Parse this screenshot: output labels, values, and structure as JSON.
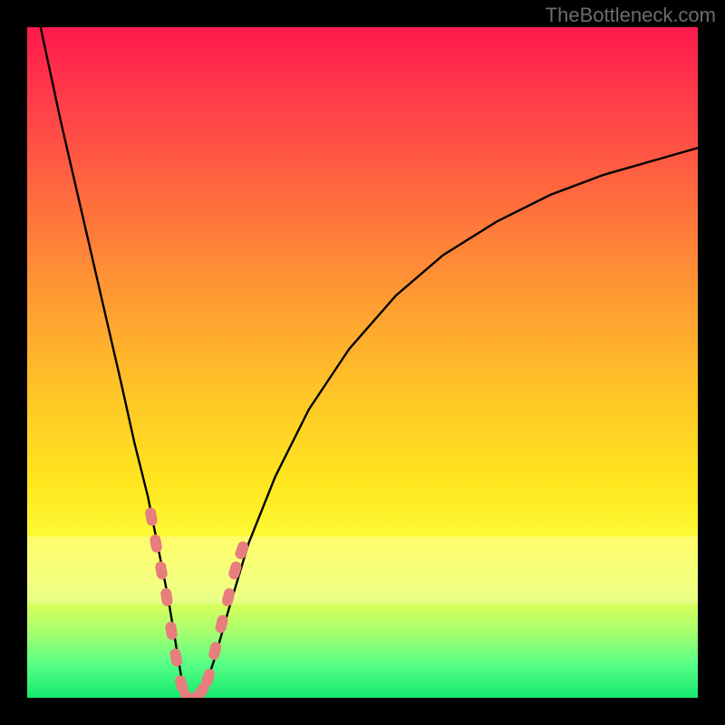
{
  "attribution": "TheBottleneck.com",
  "colors": {
    "frame": "#000000",
    "marker": "#e77d7d",
    "curve": "#000000",
    "gradient_top": "#ff1a4d",
    "gradient_bottom": "#16e96f"
  },
  "chart_data": {
    "type": "line",
    "title": "",
    "xlabel": "",
    "ylabel": "",
    "xlim": [
      0,
      100
    ],
    "ylim": [
      0,
      100
    ],
    "grid": false,
    "legend": false,
    "background": "rainbow-vertical-gradient",
    "notes": "V-shaped bottleneck curve; y ≈ 0 near the trough (~x=24), rising steeply left toward 100 and asymptotically right toward ~82. Salmon markers cluster on both branches near the trough.",
    "series": [
      {
        "name": "bottleneck-curve",
        "x": [
          2,
          5,
          8,
          11,
          14,
          16,
          18,
          19,
          20,
          21,
          22,
          23,
          24,
          25,
          26,
          27,
          28,
          30,
          33,
          37,
          42,
          48,
          55,
          62,
          70,
          78,
          86,
          93,
          100
        ],
        "y": [
          100,
          86,
          73,
          60,
          47,
          38,
          30,
          25,
          20,
          15,
          9,
          3,
          0,
          0,
          1,
          3,
          6,
          13,
          23,
          33,
          43,
          52,
          60,
          66,
          71,
          75,
          78,
          80,
          82
        ]
      }
    ],
    "markers": {
      "name": "highlighted-points",
      "color": "#e77d7d",
      "points": [
        {
          "x": 18.5,
          "y": 27
        },
        {
          "x": 19.2,
          "y": 23
        },
        {
          "x": 20.0,
          "y": 19
        },
        {
          "x": 20.8,
          "y": 15
        },
        {
          "x": 21.5,
          "y": 10
        },
        {
          "x": 22.2,
          "y": 6
        },
        {
          "x": 23.0,
          "y": 2
        },
        {
          "x": 24.0,
          "y": 0
        },
        {
          "x": 25.0,
          "y": 0
        },
        {
          "x": 26.0,
          "y": 1
        },
        {
          "x": 27.0,
          "y": 3
        },
        {
          "x": 28.0,
          "y": 7
        },
        {
          "x": 29.0,
          "y": 11
        },
        {
          "x": 30.0,
          "y": 15
        },
        {
          "x": 31.0,
          "y": 19
        },
        {
          "x": 32.0,
          "y": 22
        }
      ]
    },
    "light_band_y_range": [
      14,
      24
    ]
  }
}
